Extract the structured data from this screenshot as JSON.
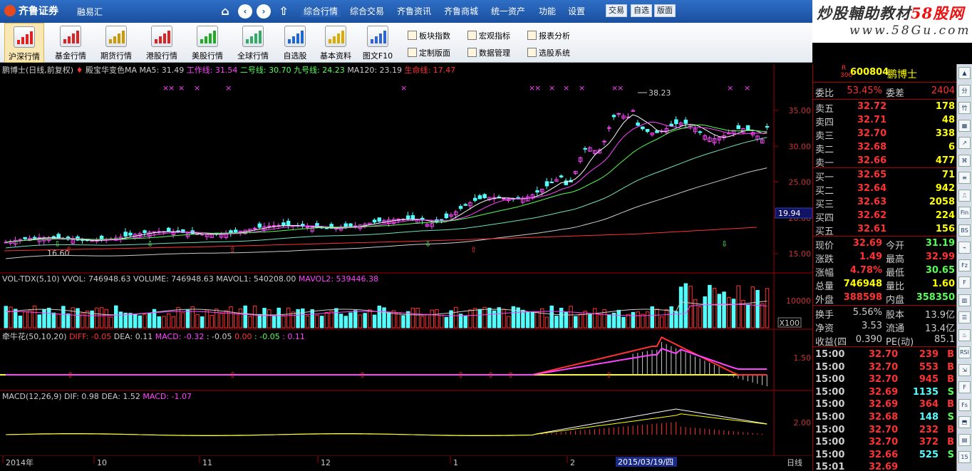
{
  "topbar": {
    "brand": "齐鲁证券",
    "sub_brand": "融易汇",
    "menus": [
      "综合行情",
      "综合交易",
      "齐鲁资讯",
      "齐鲁商城",
      "统一资产",
      "功能",
      "设置"
    ],
    "buttons": [
      "交易",
      "自选",
      "版面"
    ]
  },
  "watermark": {
    "line1a": "炒股輔助教材",
    "line1b": "58股网",
    "line2": "www.58Gu.com"
  },
  "toolbar": {
    "tools": [
      "沪深行情",
      "基金行情",
      "期货行情",
      "港股行情",
      "美股行情",
      "全球行情",
      "自选股",
      "基本资料",
      "图文F10"
    ],
    "mini": [
      "板块指数",
      "宏观指标",
      "报表分析",
      "定制版面",
      "数据管理",
      "选股系统"
    ]
  },
  "main_header": {
    "title": "鹏博士(日线,前复权)",
    "indicator": "殿宝华变色MA",
    "ma5": "MA5: 31.49",
    "gx": "工作线: 31.54",
    "ex": "二号线: 30.70",
    "jx": "九号线: 24.23",
    "ma120": "MA120: 23.19",
    "sm": "生命线: 17.47"
  },
  "vol_header": {
    "name": "VOL-TDX(5,10)",
    "vvol": "VVOL: 746948.63",
    "volume": "VOLUME: 746948.63",
    "mavol1": "MAVOL1: 540208.00",
    "mavol2": "MAVOL2: 539446.38"
  },
  "qnh_header": {
    "name": "牵牛花(50,10,20)",
    "diff": "DIFF: -0.05",
    "dea": "DEA: 0.11",
    "macd": "MACD: -0.32",
    "t1": ": -0.05",
    "t2": "0.00",
    "t3": ": -0.05",
    "t4": ": 0.11"
  },
  "macd_header": {
    "name": "MACD(12,26,9)",
    "dif": "DIF: 0.98",
    "dea": "DEA: 1.52",
    "macd": "MACD: -1.07"
  },
  "labels": {
    "high": "38.23",
    "low": "16.60",
    "current": "19.94",
    "vol_unit": "X100",
    "date_tag": "2015/03/19/四",
    "period": "日线"
  },
  "price_axis": [
    "35.00",
    "30.00",
    "25.00",
    "20.00",
    "15.00"
  ],
  "vol_axis": [
    "10000"
  ],
  "qnh_axis": [
    "1.50"
  ],
  "macd_axis": [
    "2.00"
  ],
  "time_axis": [
    "2014年",
    "10",
    "11",
    "12",
    "1",
    "2"
  ],
  "quote": {
    "code_prefix": "R",
    "code_sub": "300",
    "code": "600804",
    "name": "鹏博士",
    "weibi_label": "委比",
    "weibi": "53.45%",
    "weicha_label": "委差",
    "weicha": "2404",
    "asks": [
      {
        "label": "卖五",
        "price": "32.72",
        "vol": "178"
      },
      {
        "label": "卖四",
        "price": "32.71",
        "vol": "48"
      },
      {
        "label": "卖三",
        "price": "32.70",
        "vol": "338"
      },
      {
        "label": "卖二",
        "price": "32.68",
        "vol": "6"
      },
      {
        "label": "卖一",
        "price": "32.66",
        "vol": "477"
      }
    ],
    "bids": [
      {
        "label": "买一",
        "price": "32.65",
        "vol": "71"
      },
      {
        "label": "买二",
        "price": "32.64",
        "vol": "942"
      },
      {
        "label": "买三",
        "price": "32.63",
        "vol": "2058"
      },
      {
        "label": "买四",
        "price": "32.62",
        "vol": "224"
      },
      {
        "label": "买五",
        "price": "32.61",
        "vol": "156"
      }
    ],
    "stats": [
      {
        "l1": "现价",
        "v1": "32.69",
        "l2": "今开",
        "v2": "31.19"
      },
      {
        "l1": "涨跌",
        "v1": "1.49",
        "l2": "最高",
        "v2": "32.99"
      },
      {
        "l1": "涨幅",
        "v1": "4.78%",
        "l2": "最低",
        "v2": "30.65"
      },
      {
        "l1": "总量",
        "v1": "746948",
        "l2": "量比",
        "v2": "1.60"
      },
      {
        "l1": "外盘",
        "v1": "388598",
        "l2": "内盘",
        "v2": "358350"
      }
    ],
    "fin": [
      {
        "l1": "换手",
        "v1": "5.56%",
        "l2": "股本",
        "v2": "13.9亿"
      },
      {
        "l1": "净资",
        "v1": "3.53",
        "l2": "流通",
        "v2": "13.4亿"
      },
      {
        "l1": "收益(四",
        "v1": "0.390",
        "l2": "PE(动)",
        "v2": "85.1"
      }
    ],
    "ticks": [
      {
        "t": "15:00",
        "p": "32.70",
        "v": "239",
        "d": "B"
      },
      {
        "t": "15:00",
        "p": "32.70",
        "v": "553",
        "d": "B"
      },
      {
        "t": "15:00",
        "p": "32.70",
        "v": "945",
        "d": "B"
      },
      {
        "t": "15:00",
        "p": "32.69",
        "v": "1135",
        "d": "S"
      },
      {
        "t": "15:00",
        "p": "32.69",
        "v": "364",
        "d": "B"
      },
      {
        "t": "15:00",
        "p": "32.68",
        "v": "148",
        "d": "S"
      },
      {
        "t": "15:00",
        "p": "32.70",
        "v": "232",
        "d": "B"
      },
      {
        "t": "15:00",
        "p": "32.70",
        "v": "372",
        "d": "B"
      },
      {
        "t": "15:00",
        "p": "32.66",
        "v": "525",
        "d": "S"
      },
      {
        "t": "15:01",
        "p": "32.69",
        "v": "",
        "d": ""
      }
    ]
  },
  "sidebar": [
    "▲",
    "分",
    "竹",
    "▦",
    "↗",
    "⌘",
    "≡",
    "⎍",
    "Fin",
    "BS",
    "⌁",
    "Fz",
    "F",
    "▥",
    "☰",
    "♨",
    "RSI",
    "⇲",
    "F",
    "Fs",
    "⬒",
    "▤",
    "15"
  ],
  "colors": {
    "up": "#ff44ff",
    "down": "#54ffff",
    "red": "#ff3232",
    "yellow": "#ffff00",
    "green": "#00ff00",
    "axis": "#a00000"
  }
}
